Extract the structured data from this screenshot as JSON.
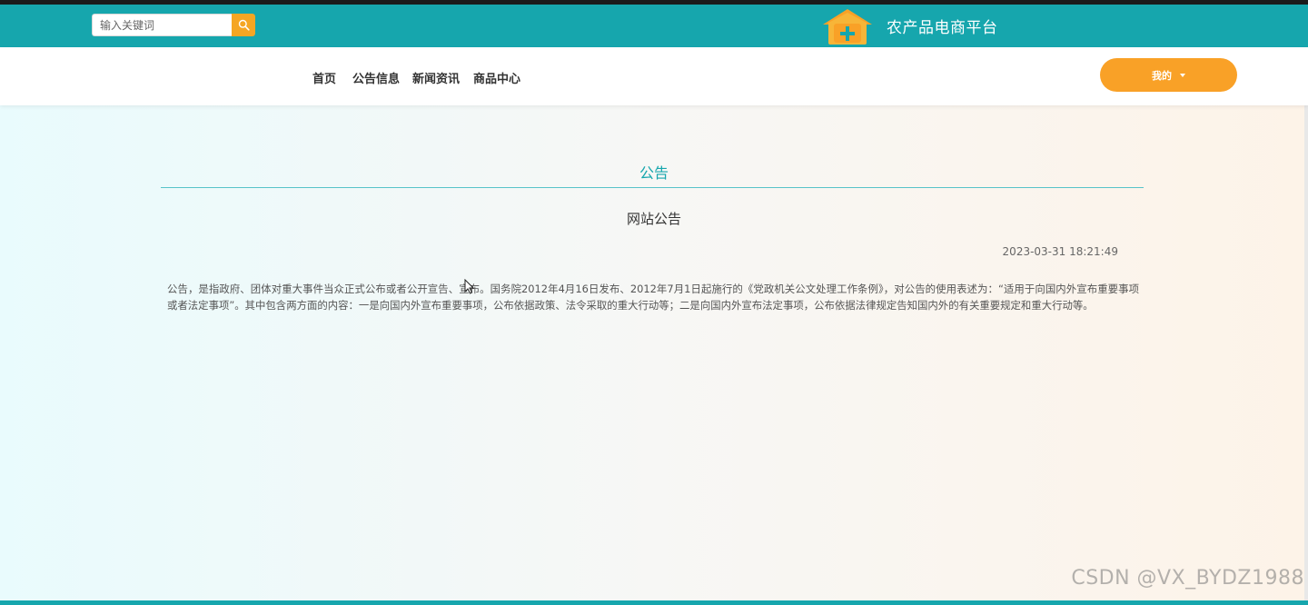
{
  "search": {
    "placeholder": "输入关键词"
  },
  "header": {
    "site_title": "农产品电商平台",
    "logo_icon": "house-plus-icon"
  },
  "nav": {
    "items": [
      {
        "label": "首页"
      },
      {
        "label": "公告信息"
      },
      {
        "label": "新闻资讯"
      },
      {
        "label": "商品中心"
      }
    ],
    "user_menu_label": "我的"
  },
  "main": {
    "section_title": "公告",
    "notice_title": "网站公告",
    "notice_time": "2023-03-31 18:21:49",
    "notice_body": "公告，是指政府、团体对重大事件当众正式公布或者公开宣告、宣布。国务院2012年4月16日发布、2012年7月1日起施行的《党政机关公文处理工作条例》，对公告的使用表述为：“适用于向国内外宣布重要事项或者法定事项”。其中包含两方面的内容：一是向国内外宣布重要事项，公布依据政策、法令采取的重大行动等；二是向国内外宣布法定事项，公布依据法律规定告知国内外的有关重要规定和重大行动等。"
  },
  "watermark": "CSDN @VX_BYDZ1988",
  "colors": {
    "primary": "#16a6ad",
    "accent": "#f9a127"
  }
}
